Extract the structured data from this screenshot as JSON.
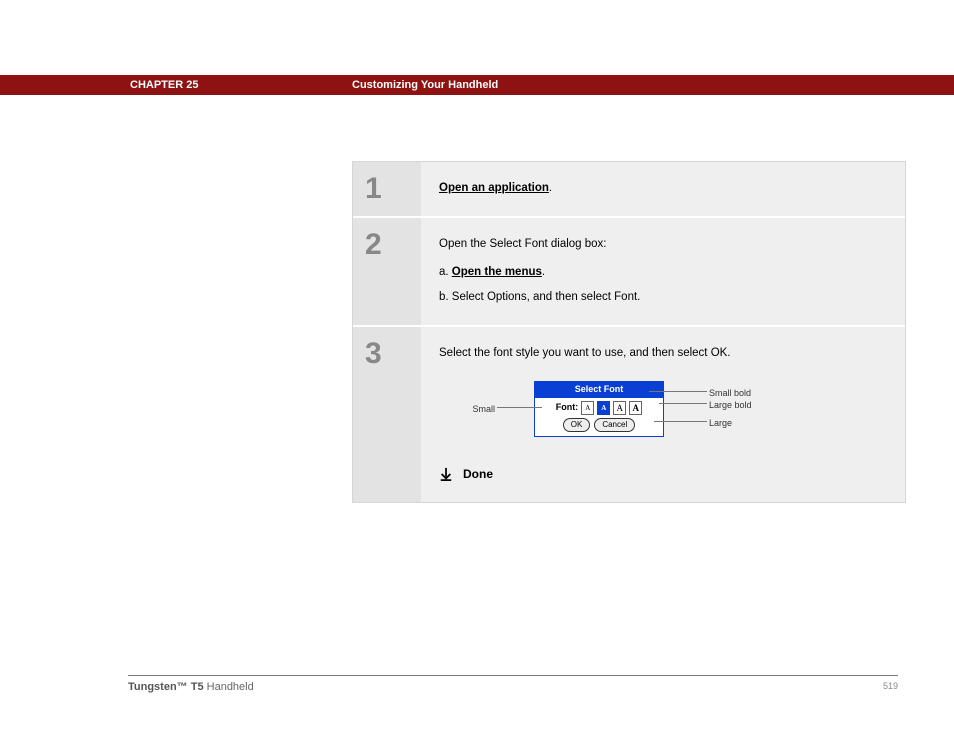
{
  "header": {
    "chapter": "CHAPTER 25",
    "title": "Customizing Your Handheld"
  },
  "steps": {
    "s1": {
      "num": "1",
      "link": "Open an application",
      "period": "."
    },
    "s2": {
      "num": "2",
      "intro": "Open the Select Font dialog box:",
      "a_prefix": "a.  ",
      "a_link": "Open the menus",
      "a_period": ".",
      "b": "b.  Select Options, and then select Font."
    },
    "s3": {
      "num": "3",
      "text": "Select the font style you want to use, and then select OK.",
      "dialog": {
        "title": "Select Font",
        "label": "Font:",
        "ok": "OK",
        "cancel": "Cancel"
      },
      "callouts": {
        "small": "Small",
        "smallBold": "Small bold",
        "largeBold": "Large bold",
        "large": "Large"
      },
      "done": "Done"
    }
  },
  "footer": {
    "productBold": "Tungsten™ T5",
    "productRest": " Handheld",
    "page": "519"
  }
}
